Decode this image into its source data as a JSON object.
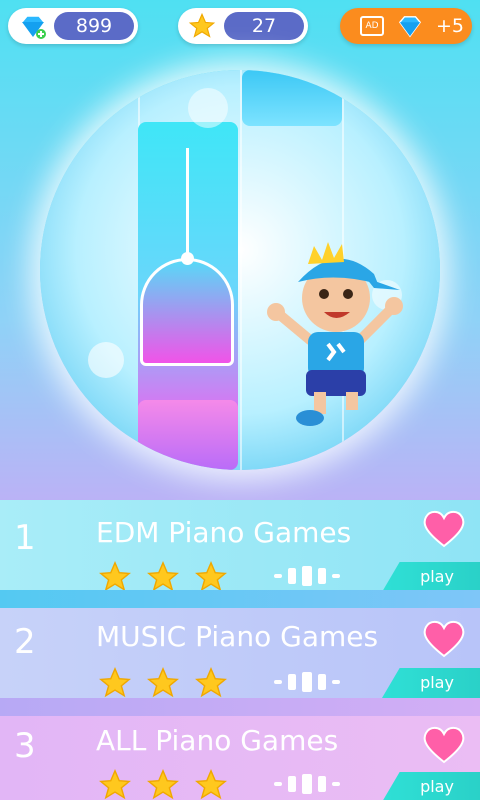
{
  "top": {
    "diamonds": "899",
    "stars": "27",
    "ad_label": "AD",
    "ad_reward": "+5"
  },
  "songs": [
    {
      "index": "1",
      "title": "EDM Piano Games",
      "stars": 3,
      "play": "play"
    },
    {
      "index": "2",
      "title": "MUSIC Piano Games",
      "stars": 3,
      "play": "play"
    },
    {
      "index": "3",
      "title": "ALL Piano Games",
      "stars": 3,
      "play": "play"
    }
  ],
  "colors": {
    "diamond_value_bg": "#5b6bc7",
    "ad_button": "#fb8c1e",
    "play_button": "#2fe0d6",
    "heart": "#ff5fa8",
    "star": "#ffc81e"
  }
}
